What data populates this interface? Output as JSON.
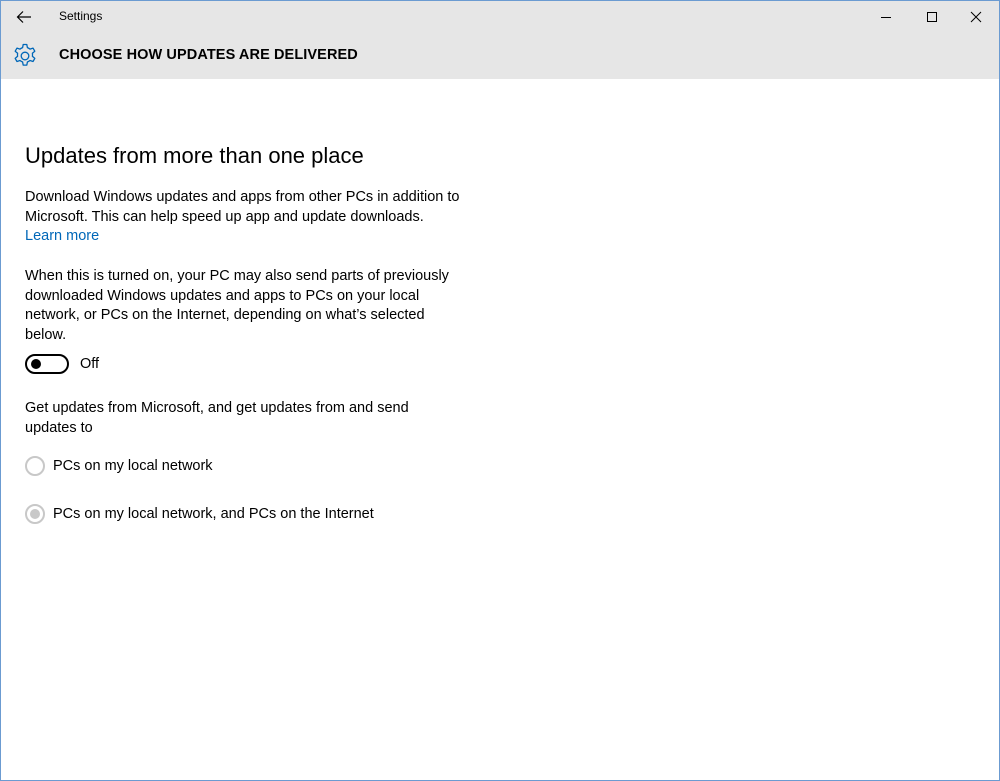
{
  "window": {
    "title": "Settings"
  },
  "header": {
    "title": "CHOOSE HOW UPDATES ARE DELIVERED",
    "icon": "gear-icon"
  },
  "content": {
    "section_title": "Updates from more than one place",
    "description": "Download Windows updates and apps from other PCs in addition to Microsoft. This can help speed up app and update downloads.",
    "learn_more": "Learn more",
    "toggle_description": "When this is turned on, your PC may also send parts of previously downloaded Windows updates and apps to PCs on your local network, or PCs on the Internet, depending on what’s selected below.",
    "toggle": {
      "state": "off",
      "label": "Off"
    },
    "radio_prompt": "Get updates from Microsoft, and get updates from and send updates to",
    "radio_options": [
      {
        "label": "PCs on my local network",
        "selected": false
      },
      {
        "label": "PCs on my local network, and PCs on the Internet",
        "selected": true
      }
    ]
  },
  "colors": {
    "accent": "#0067b8",
    "titlebar": "#e6e6e6",
    "disabled": "#c8c8c8"
  }
}
